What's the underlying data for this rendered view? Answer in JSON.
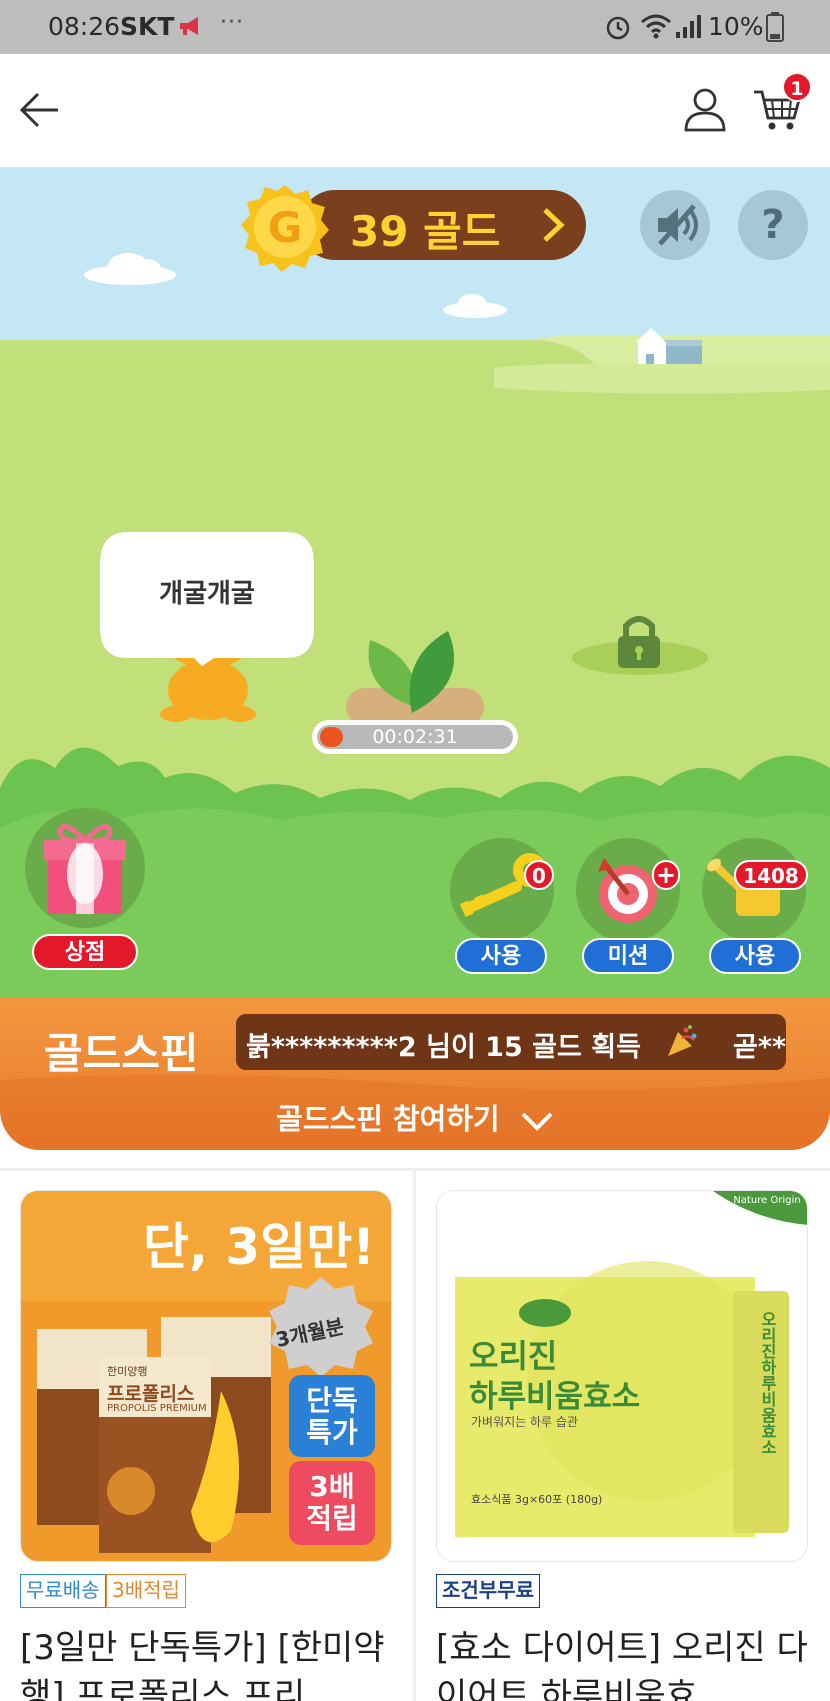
{
  "status_bar": {
    "time": "08:26",
    "carrier": "SKT",
    "dots": "···",
    "battery": "10%"
  },
  "header": {
    "cart_count": "1"
  },
  "game": {
    "gold_amount": "39 골드",
    "speech_text": "개굴개굴",
    "timer": "00:02:31",
    "timer_progress": 0.08,
    "help_label": "?",
    "shop_label": "상점",
    "key": {
      "count": "0",
      "label": "사용"
    },
    "mission": {
      "count": "+",
      "label": "미션"
    },
    "water": {
      "count": "1408",
      "label": "사용"
    }
  },
  "gold_spin": {
    "title": "골드스핀",
    "ticker_main": "붉*********2 님이 15 골드 획득",
    "ticker_next": "곧**",
    "join_label": "골드스핀 참여하기"
  },
  "products": [
    {
      "tags": [
        "무료배송",
        "3배적립"
      ],
      "title": "[3일만 단독특가] [한미약행] 프로폴리스 프리…",
      "image_texts": {
        "headline": "단, 3일만!",
        "seal": "3개월분",
        "badge1": "단독\n특가",
        "badge2": "3배\n적립",
        "brand": "한미양행",
        "name": "프로폴리스",
        "sub": "PROPOLIS PREMIUM"
      }
    },
    {
      "tags": [
        "조건부무료"
      ],
      "title": "[효소 다이어트] 오리진 다이어트 하루비움효…",
      "image_texts": {
        "corner": "Nature Origin",
        "name1": "오리진",
        "name2": "하루비움효소",
        "tagline": "가벼워지는 하루 습관",
        "spec": "효소식품 3g×60포 (180g)",
        "stick": "오리진하루비움효소"
      }
    }
  ],
  "colors": {
    "accent_orange": "#f0883a",
    "badge_red": "#e4182b",
    "pill_blue": "#1f6fd6",
    "gold_pill": "#7a3f1c"
  }
}
